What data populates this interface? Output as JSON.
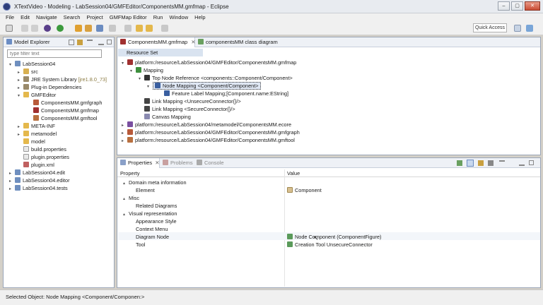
{
  "window": {
    "title": "XTextVideo - Modeling - LabSession04/GMFEditor/ComponentsMM.gmfmap - Eclipse",
    "buttons": [
      "–",
      "▢",
      "✕"
    ]
  },
  "menu": [
    "File",
    "Edit",
    "Navigate",
    "Search",
    "Project",
    "GMFMap Editor",
    "Run",
    "Window",
    "Help"
  ],
  "toolbar": {
    "quick_access": "Quick Access"
  },
  "explorer": {
    "tab_label": "Model Explorer",
    "filter_placeholder": "type filter text",
    "items": [
      {
        "label": "LabSession04",
        "depth": 0,
        "twisty": "▾",
        "icon": "project-icon"
      },
      {
        "label": "src",
        "depth": 1,
        "twisty": "▸",
        "icon": "source-folder-icon"
      },
      {
        "label": "JRE System Library",
        "suffix": "[jre1.8.0_73]",
        "depth": 1,
        "twisty": "▸",
        "icon": "library-icon"
      },
      {
        "label": "Plug-in Dependencies",
        "depth": 1,
        "twisty": "▸",
        "icon": "library-icon"
      },
      {
        "label": "GMFEditor",
        "depth": 1,
        "twisty": "▾",
        "icon": "folder-icon"
      },
      {
        "label": "ComponentsMM.gmfgraph",
        "depth": 2,
        "twisty": "",
        "icon": "gmfgraph-icon"
      },
      {
        "label": "ComponentsMM.gmfmap",
        "depth": 2,
        "twisty": "",
        "icon": "gmfmap-icon"
      },
      {
        "label": "ComponentsMM.gmftool",
        "depth": 2,
        "twisty": "",
        "icon": "gmftool-icon"
      },
      {
        "label": "META-INF",
        "depth": 1,
        "twisty": "▸",
        "icon": "folder-icon"
      },
      {
        "label": "metamodel",
        "depth": 1,
        "twisty": "▸",
        "icon": "folder-icon"
      },
      {
        "label": "model",
        "depth": 1,
        "twisty": "",
        "icon": "folder-icon"
      },
      {
        "label": "build.properties",
        "depth": 1,
        "twisty": "",
        "icon": "file-icon"
      },
      {
        "label": "plugin.properties",
        "depth": 1,
        "twisty": "",
        "icon": "file-icon"
      },
      {
        "label": "plugin.xml",
        "depth": 1,
        "twisty": "",
        "icon": "plugin-icon"
      },
      {
        "label": "LabSession04.edit",
        "depth": 0,
        "twisty": "▸",
        "icon": "project-icon"
      },
      {
        "label": "LabSession04.editor",
        "depth": 0,
        "twisty": "▸",
        "icon": "project-icon"
      },
      {
        "label": "LabSession04.tests",
        "depth": 0,
        "twisty": "▸",
        "icon": "project-icon"
      }
    ]
  },
  "editor": {
    "tabs": [
      {
        "label": "ComponentsMM.gmfmap",
        "active": true
      },
      {
        "label": "componentsMM class diagram",
        "active": false
      }
    ],
    "resource_set": "Resource Set",
    "tree": [
      {
        "label": "platform:/resource/LabSession04/GMFEditor/ComponentsMM.gmfmap",
        "depth": 0,
        "twisty": "▾",
        "color": "#b03a2e"
      },
      {
        "label": "Mapping",
        "depth": 1,
        "twisty": "▾",
        "color": "#3d8f3d"
      },
      {
        "label": "Top Node Reference <components::Component/Component>",
        "depth": 2,
        "twisty": "▾",
        "color": "#333333"
      },
      {
        "label": "Node Mapping <Component/Component>",
        "depth": 3,
        "twisty": "▾",
        "color": "#3a5fa0",
        "selected": true
      },
      {
        "label": "Feature Label Mapping;[Component.name:EString]",
        "depth": 4,
        "twisty": "",
        "color": "#3a5fa0"
      },
      {
        "label": "Link Mapping <UnsecureConnector{}/>",
        "depth": 2,
        "twisty": "",
        "color": "#333333"
      },
      {
        "label": "Link Mapping <SecureConnector{}/>",
        "depth": 2,
        "twisty": "",
        "color": "#333333"
      },
      {
        "label": "Canvas Mapping",
        "depth": 2,
        "twisty": "",
        "color": "#7a7aa0"
      },
      {
        "label": "platform:/resource/LabSession04/metamodel/ComponentsMM.ecore",
        "depth": 0,
        "twisty": "▸",
        "color": "#7a4fa0"
      },
      {
        "label": "platform:/resource/LabSession04/GMFEditor/ComponentsMM.gmfgraph",
        "depth": 0,
        "twisty": "▸",
        "color": "#b03a2e"
      },
      {
        "label": "platform:/resource/LabSession04/GMFEditor/ComponentsMM.gmftool",
        "depth": 0,
        "twisty": "▸",
        "color": "#b03a2e"
      }
    ]
  },
  "properties": {
    "tabs": [
      {
        "label": "Properties",
        "active": true
      },
      {
        "label": "Problems",
        "active": false
      },
      {
        "label": "Console",
        "active": false
      }
    ],
    "columns": [
      "Property",
      "Value"
    ],
    "rows": [
      {
        "property": "Domain meta information",
        "value": "",
        "depth": 0,
        "twisty": "▴"
      },
      {
        "property": "Element",
        "value": "Component",
        "depth": 1,
        "twisty": "",
        "value_icon": "class-icon"
      },
      {
        "property": "Misc",
        "value": "",
        "depth": 0,
        "twisty": "▴"
      },
      {
        "property": "Related Diagrams",
        "value": "",
        "depth": 1,
        "twisty": ""
      },
      {
        "property": "Visual representation",
        "value": "",
        "depth": 0,
        "twisty": "▴"
      },
      {
        "property": "Appearance Style",
        "value": "",
        "depth": 1,
        "twisty": ""
      },
      {
        "property": "Context Menu",
        "value": "",
        "depth": 1,
        "twisty": ""
      },
      {
        "property": "Diagram Node",
        "value": "Node Component (ComponentFigure)",
        "depth": 1,
        "twisty": "",
        "value_icon": "node-icon"
      },
      {
        "property": "Tool",
        "value": "Creation Tool UnsecureConnector",
        "depth": 1,
        "twisty": "",
        "value_icon": "tool-icon"
      }
    ]
  },
  "status": {
    "text": "Selected Object: Node Mapping <Component/Componen:>"
  }
}
